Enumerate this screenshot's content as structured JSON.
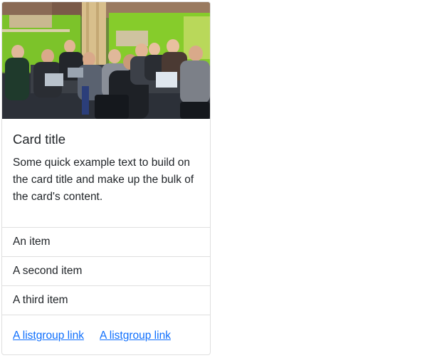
{
  "card": {
    "image_alt": "Group of people working at laptops around a table",
    "title": "Card title",
    "text": "Some quick example text to build on the card title and make up the bulk of the card's content.",
    "items": [
      {
        "label": "An item"
      },
      {
        "label": "A second item"
      },
      {
        "label": "A third item"
      }
    ],
    "links": [
      {
        "label": "A listgroup link"
      },
      {
        "label": "A listgroup link"
      }
    ]
  },
  "colors": {
    "link": "#0d6efd",
    "text": "#212529",
    "border": "rgba(0,0,0,0.125)"
  }
}
